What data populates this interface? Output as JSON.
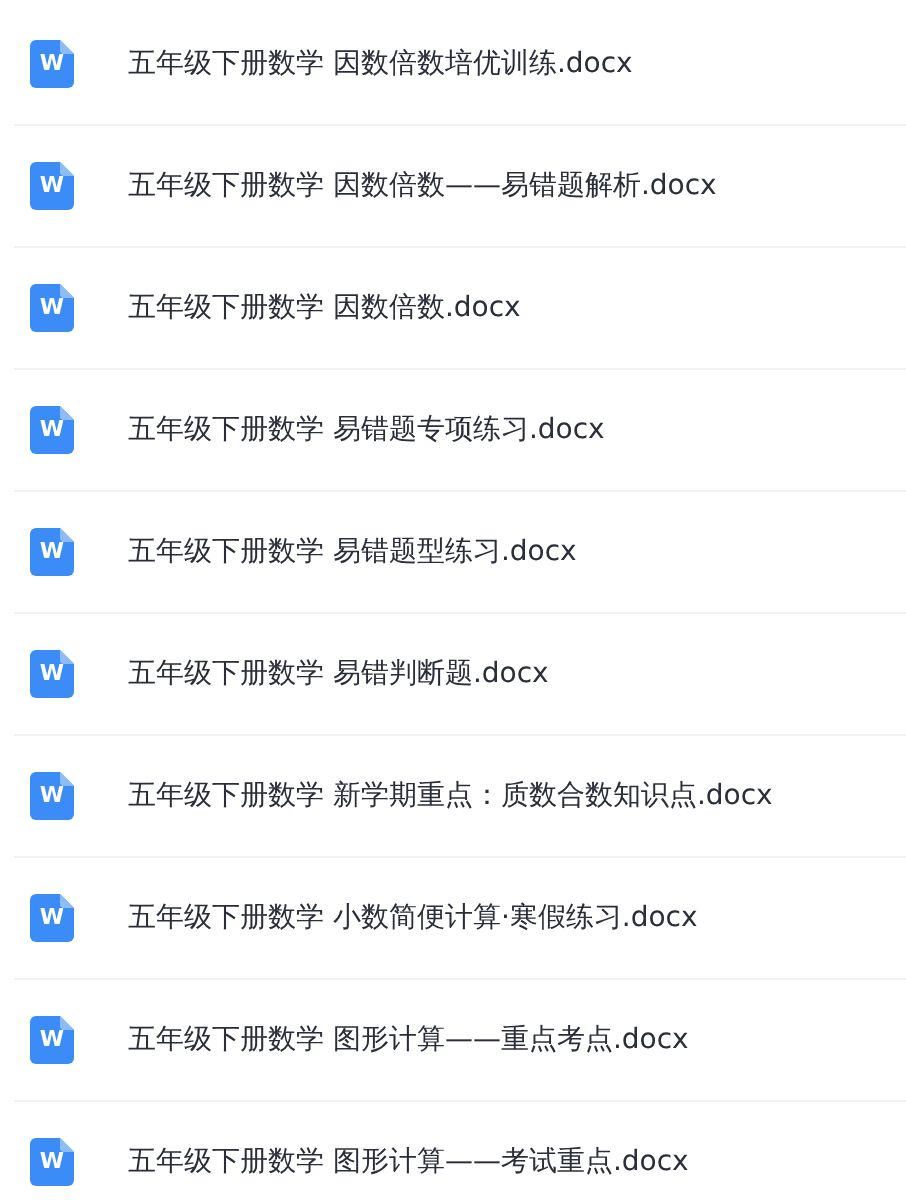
{
  "files": [
    {
      "name": "五年级下册数学 因数倍数培优训练.docx",
      "icon_label": "W"
    },
    {
      "name": "五年级下册数学 因数倍数——易错题解析.docx",
      "icon_label": "W"
    },
    {
      "name": "五年级下册数学 因数倍数.docx",
      "icon_label": "W"
    },
    {
      "name": "五年级下册数学 易错题专项练习.docx",
      "icon_label": "W"
    },
    {
      "name": "五年级下册数学 易错题型练习.docx",
      "icon_label": "W"
    },
    {
      "name": "五年级下册数学 易错判断题.docx",
      "icon_label": "W"
    },
    {
      "name": "五年级下册数学 新学期重点：质数合数知识点.docx",
      "icon_label": "W"
    },
    {
      "name": "五年级下册数学 小数简便计算·寒假练习.docx",
      "icon_label": "W"
    },
    {
      "name": "五年级下册数学 图形计算——重点考点.docx",
      "icon_label": "W"
    },
    {
      "name": "五年级下册数学 图形计算——考试重点.docx",
      "icon_label": "W"
    }
  ]
}
